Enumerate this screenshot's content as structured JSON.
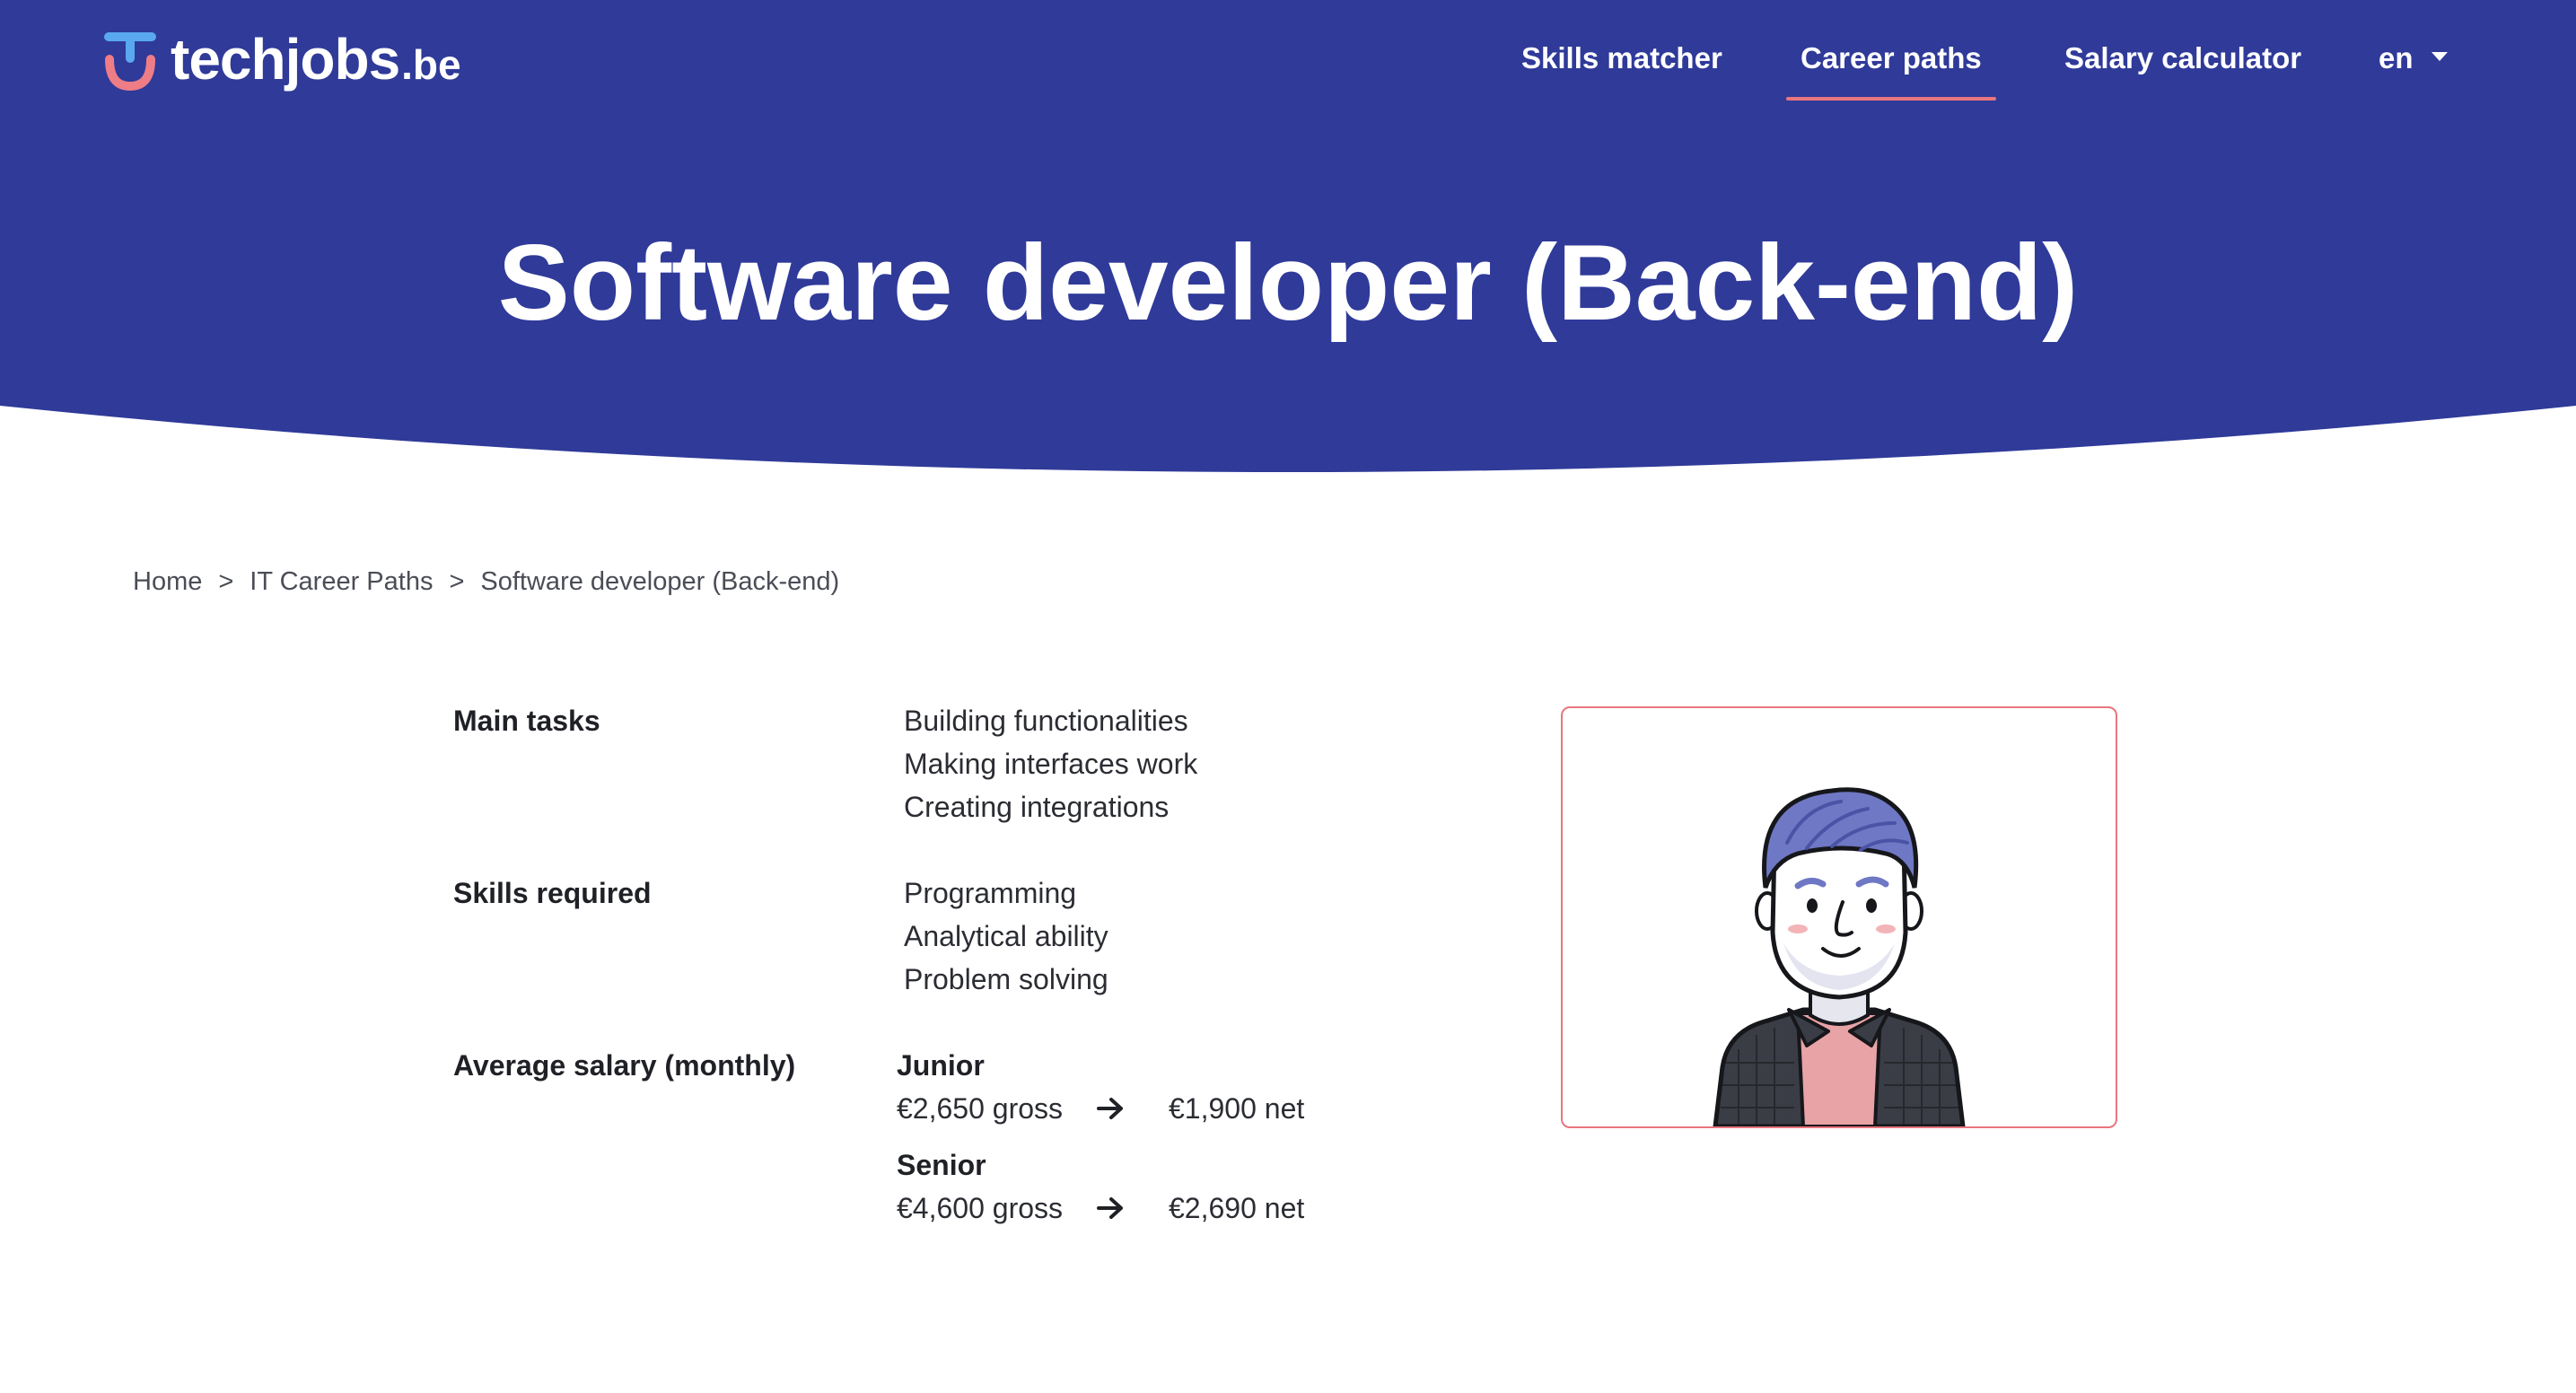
{
  "brand": {
    "name": "techjobs",
    "tld": ".be",
    "colors": {
      "header_bg": "#2f3a99",
      "accent": "#e9767e",
      "logo_blue": "#5aa8f0",
      "logo_pink": "#ee7d86"
    }
  },
  "nav": {
    "items": [
      {
        "label": "Skills matcher",
        "active": false
      },
      {
        "label": "Career paths",
        "active": true
      },
      {
        "label": "Salary calculator",
        "active": false
      }
    ],
    "language": "en"
  },
  "page": {
    "title": "Software developer (Back-end)"
  },
  "breadcrumb": {
    "items": [
      "Home",
      "IT Career Paths",
      "Software developer (Back-end)"
    ],
    "separator": ">"
  },
  "details": {
    "main_tasks": {
      "label": "Main tasks",
      "items": [
        "Building functionalities",
        "Making interfaces work",
        "Creating integrations"
      ]
    },
    "skills": {
      "label": "Skills required",
      "items": [
        "Programming",
        "Analytical ability",
        "Problem solving"
      ]
    },
    "salary": {
      "label": "Average salary (monthly)",
      "levels": [
        {
          "name": "Junior",
          "gross": "€2,650 gross",
          "net": "€1,900 net"
        },
        {
          "name": "Senior",
          "gross": "€4,600 gross",
          "net": "€2,690 net"
        }
      ]
    }
  },
  "illustration": {
    "icon": "developer-avatar-illustration"
  }
}
